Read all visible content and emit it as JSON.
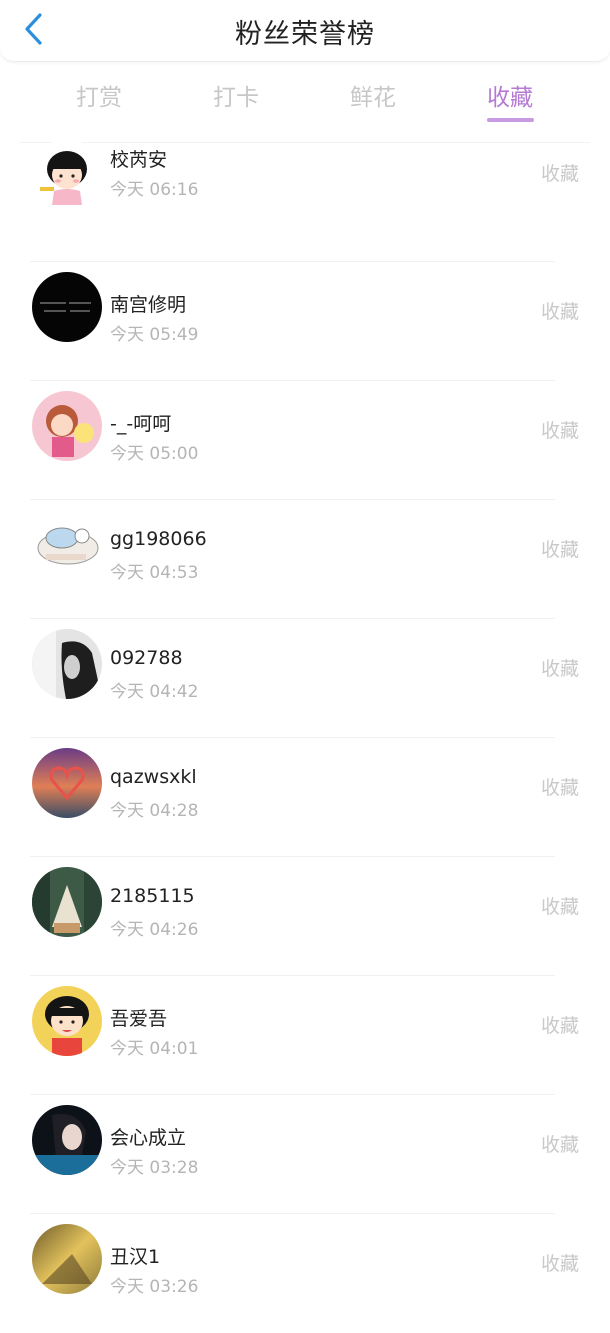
{
  "header": {
    "title": "粉丝荣誉榜",
    "back_icon": "chevron-left-icon",
    "accent_color": "#2b8fe0"
  },
  "tabs": [
    {
      "label": "打赏",
      "active": false
    },
    {
      "label": "打卡",
      "active": false
    },
    {
      "label": "鲜花",
      "active": false
    },
    {
      "label": "收藏",
      "active": true
    }
  ],
  "active_tab_color": "#b57ad4",
  "list": [
    {
      "name": "校芮安",
      "time": "今天 06:16",
      "action": "收藏",
      "avatar": "cartoon-girl"
    },
    {
      "name": "南宫修明",
      "time": "今天 05:49",
      "action": "收藏",
      "avatar": "black-text"
    },
    {
      "name": "-_-呵呵",
      "time": "今天 05:00",
      "action": "收藏",
      "avatar": "cartoon-pink"
    },
    {
      "name": "gg198066",
      "time": "今天 04:53",
      "action": "收藏",
      "avatar": "cartoon-white"
    },
    {
      "name": "092788",
      "time": "今天 04:42",
      "action": "收藏",
      "avatar": "bw-photo"
    },
    {
      "name": "qazwsxkl",
      "time": "今天 04:28",
      "action": "收藏",
      "avatar": "sunset-heart"
    },
    {
      "name": "2185115",
      "time": "今天 04:26",
      "action": "收藏",
      "avatar": "forest"
    },
    {
      "name": "吾爱吾",
      "time": "今天 04:01",
      "action": "收藏",
      "avatar": "maruko"
    },
    {
      "name": "会心成立",
      "time": "今天 03:28",
      "action": "收藏",
      "avatar": "dark-photo"
    },
    {
      "name": "丑汉1",
      "time": "今天 03:26",
      "action": "收藏",
      "avatar": "yellow-scene"
    }
  ]
}
